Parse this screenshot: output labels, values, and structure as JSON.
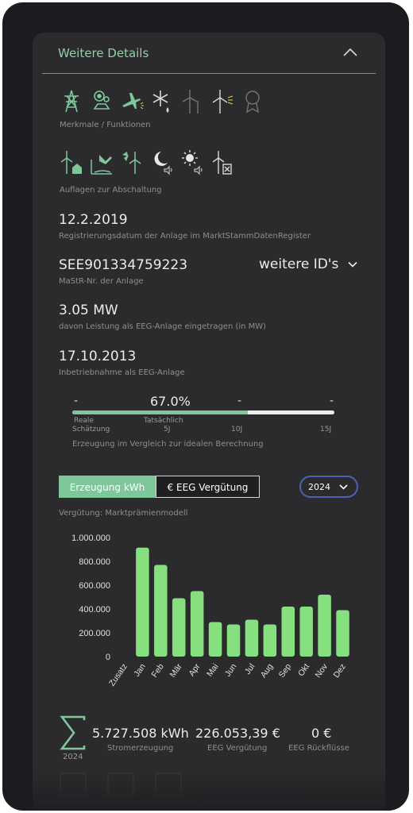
{
  "header": {
    "title": "Weitere Details"
  },
  "features": {
    "caption": "Merkmale / Funktionen",
    "icons": [
      "power-pylon-icon",
      "map-pin-person-icon",
      "airplane-light-icon",
      "snowflake-drop-icon",
      "wind-turbine-icon",
      "wind-turbine-light-icon",
      "award-ribbon-icon"
    ]
  },
  "shutdown": {
    "caption": "Auflagen zur Abschaltung",
    "icons": [
      "turbine-house-icon",
      "shadow-slope-icon",
      "bird-turbine-icon",
      "moon-sound-icon",
      "sun-sound-icon",
      "turbine-document-icon"
    ]
  },
  "registration": {
    "date": "12.2.2019",
    "caption": "Registrierungsdatum der Anlage im MarktStammDatenRegister"
  },
  "mastr": {
    "id": "SEE901334759223",
    "caption": "MaStR-Nr. der Anlage",
    "more_ids": "weitere ID's"
  },
  "power": {
    "value": "3.05 MW",
    "caption": "davon Leistung als EEG-Anlage eingetragen (in MW)"
  },
  "commissioning": {
    "date": "17.10.2013",
    "caption": "Inbetriebnahme als EEG-Anlage"
  },
  "comparison": {
    "percent": "67.0%",
    "progress_fraction": 0.67,
    "dash1": "-",
    "dash2": "-",
    "dash3": "-",
    "real_label": "Reale",
    "actual_label": "Tatsächlich",
    "estimate_label": "Schätzung",
    "tick_5": "5J",
    "tick_10": "10J",
    "tick_15": "15J",
    "caption": "Erzeugung im Vergleich zur idealen Berechnung"
  },
  "toggle": {
    "left": "Erzeugung kWh",
    "right": "€ EEG Vergütung",
    "active": "left"
  },
  "year_select": {
    "value": "2024"
  },
  "remuneration_model": "Vergütung: Marktprämienmodell",
  "chart_data": {
    "type": "bar",
    "categories": [
      "Zusatz",
      "Jan",
      "Feb",
      "Mär",
      "Apr",
      "Mai",
      "Jun",
      "Jul",
      "Aug",
      "Sep",
      "Okt",
      "Nov",
      "Dez"
    ],
    "values": [
      0,
      915000,
      770000,
      490000,
      550000,
      290000,
      270000,
      310000,
      270000,
      420000,
      420000,
      520000,
      390000
    ],
    "ylim": [
      0,
      1000000
    ],
    "yticks": [
      "0",
      "200.000",
      "400.000",
      "600.000",
      "800.000",
      "1.000.000"
    ],
    "color": "#86e07f",
    "grid": false
  },
  "summary": {
    "sigma_year": "2024",
    "generation_value": "5.727.508 kWh",
    "generation_label": "Stromerzeugung",
    "eeg_value": "226.053,39 €",
    "eeg_label": "EEG Vergütung",
    "refund_value": "0 €",
    "refund_label": "EEG Rückflüsse"
  },
  "colors": {
    "accent": "#7fc79b",
    "panel": "#2b2b2d",
    "frame": "#1b1c1f",
    "bar": "#86e07f",
    "select_border": "#4b63b6"
  }
}
